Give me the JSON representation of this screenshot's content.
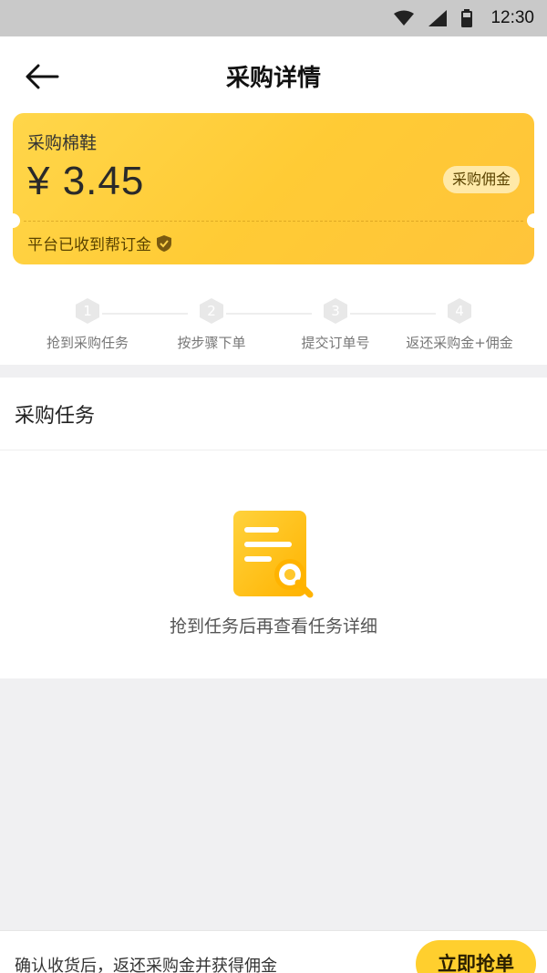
{
  "status_bar": {
    "time": "12:30",
    "icons": [
      "wifi-icon",
      "cell-signal-icon",
      "battery-icon"
    ]
  },
  "header": {
    "title": "采购详情",
    "back_icon": "arrow-left-icon"
  },
  "ticket": {
    "item_name": "采购棉鞋",
    "price": "¥ 3.45",
    "tag": "采购佣金",
    "deposit_status": "平台已收到帮订金",
    "deposit_icon": "shield-check-icon",
    "colors": {
      "bg_start": "#ffd64a",
      "bg_end": "#ffc43a",
      "tag_bg": "#ffe9a8"
    }
  },
  "steps": [
    {
      "number": "1",
      "label": "抢到采购任务"
    },
    {
      "number": "2",
      "label": "按步骤下单"
    },
    {
      "number": "3",
      "label": "提交订单号"
    },
    {
      "number": "4",
      "label": "返还采购金+佣金"
    }
  ],
  "task_section": {
    "title": "采购任务",
    "empty_icon": "document-search-icon",
    "empty_text": "抢到任务后再查看任务详细"
  },
  "bottom_bar": {
    "hint": "确认收货后，返还采购金并获得佣金",
    "cta_label": "立即抢单",
    "accent": "#ffcf2e"
  }
}
